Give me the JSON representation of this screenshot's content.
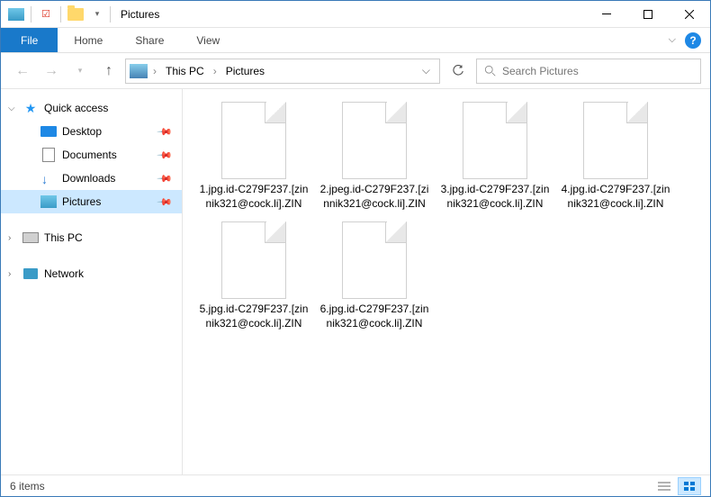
{
  "titlebar": {
    "title": "Pictures"
  },
  "ribbon": {
    "file": "File",
    "home": "Home",
    "share": "Share",
    "view": "View"
  },
  "breadcrumb": {
    "root": "This PC",
    "current": "Pictures"
  },
  "search": {
    "placeholder": "Search Pictures"
  },
  "sidebar": {
    "quick_access": "Quick access",
    "items": [
      {
        "label": "Desktop",
        "icon": "desktop",
        "pinned": true
      },
      {
        "label": "Documents",
        "icon": "docs",
        "pinned": true
      },
      {
        "label": "Downloads",
        "icon": "downloads",
        "pinned": true
      },
      {
        "label": "Pictures",
        "icon": "pictures",
        "pinned": true,
        "selected": true
      }
    ],
    "this_pc": "This PC",
    "network": "Network"
  },
  "files": [
    {
      "name": "1.jpg.id-C279F237.[zinnik321@cock.li].ZIN"
    },
    {
      "name": "2.jpeg.id-C279F237.[zinnik321@cock.li].ZIN"
    },
    {
      "name": "3.jpg.id-C279F237.[zinnik321@cock.li].ZIN"
    },
    {
      "name": "4.jpg.id-C279F237.[zinnik321@cock.li].ZIN"
    },
    {
      "name": "5.jpg.id-C279F237.[zinnik321@cock.li].ZIN"
    },
    {
      "name": "6.jpg.id-C279F237.[zinnik321@cock.li].ZIN"
    }
  ],
  "statusbar": {
    "count_label": "6 items"
  }
}
